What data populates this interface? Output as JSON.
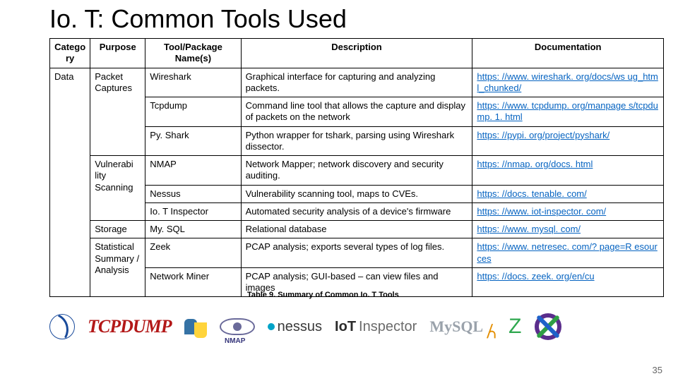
{
  "title": "Io. T: Common Tools Used",
  "caption": "Table 9. Summary of Common Io. T Tools",
  "page_number": "35",
  "headers": {
    "category": "Catego ry",
    "purpose": "Purpose",
    "tool": "Tool/Package Name(s)",
    "description": "Description",
    "documentation": "Documentation"
  },
  "category": "Data",
  "groups": [
    {
      "purpose": "Packet Captures",
      "rows": [
        {
          "tool": "Wireshark",
          "description": "Graphical interface for capturing and analyzing packets.",
          "doc": "https: //www. wireshark. org/docs/ws ug_html_chunked/"
        },
        {
          "tool": "Tcpdump",
          "description": "Command line tool that allows the capture and display of packets on the network",
          "doc": "https: //www. tcpdump. org/manpage s/tcpdump. 1. html"
        },
        {
          "tool": "Py. Shark",
          "description": "Python wrapper for tshark, parsing using Wireshark dissector.",
          "doc": "https: //pypi. org/project/pyshark/"
        }
      ]
    },
    {
      "purpose": "Vulnerabi lity Scanning",
      "rows": [
        {
          "tool": "NMAP",
          "description": "Network Mapper; network discovery and security auditing.",
          "doc": "https: //nmap. org/docs. html"
        },
        {
          "tool": "Nessus",
          "description": "Vulnerability scanning tool, maps to CVEs.",
          "doc": "https: //docs. tenable. com/"
        },
        {
          "tool": "Io. T Inspector",
          "description": "Automated security analysis of a device's firmware",
          "doc": "https: //www. iot-inspector. com/"
        }
      ]
    },
    {
      "purpose": "Storage",
      "rows": [
        {
          "tool": "My. SQL",
          "description": "Relational database",
          "doc": "https: //www. mysql. com/"
        }
      ]
    },
    {
      "purpose": "Statistical Summary / Analysis",
      "rows": [
        {
          "tool": "Zeek",
          "description": "PCAP analysis; exports several types of log files.",
          "doc": "https: //www. netresec. com/? page=R esources"
        },
        {
          "tool": "Network Miner",
          "description": "PCAP analysis; GUI-based – can view files and images",
          "doc": "https: //docs. zeek. org/en/cu"
        }
      ]
    }
  ],
  "logos": {
    "tcpdump": "TCPDUMP",
    "nmap": "NMAP",
    "nessus": "nessus",
    "iot_prefix": "IoT",
    "iot_suffix": "Inspector",
    "mysql": "MySQL"
  }
}
